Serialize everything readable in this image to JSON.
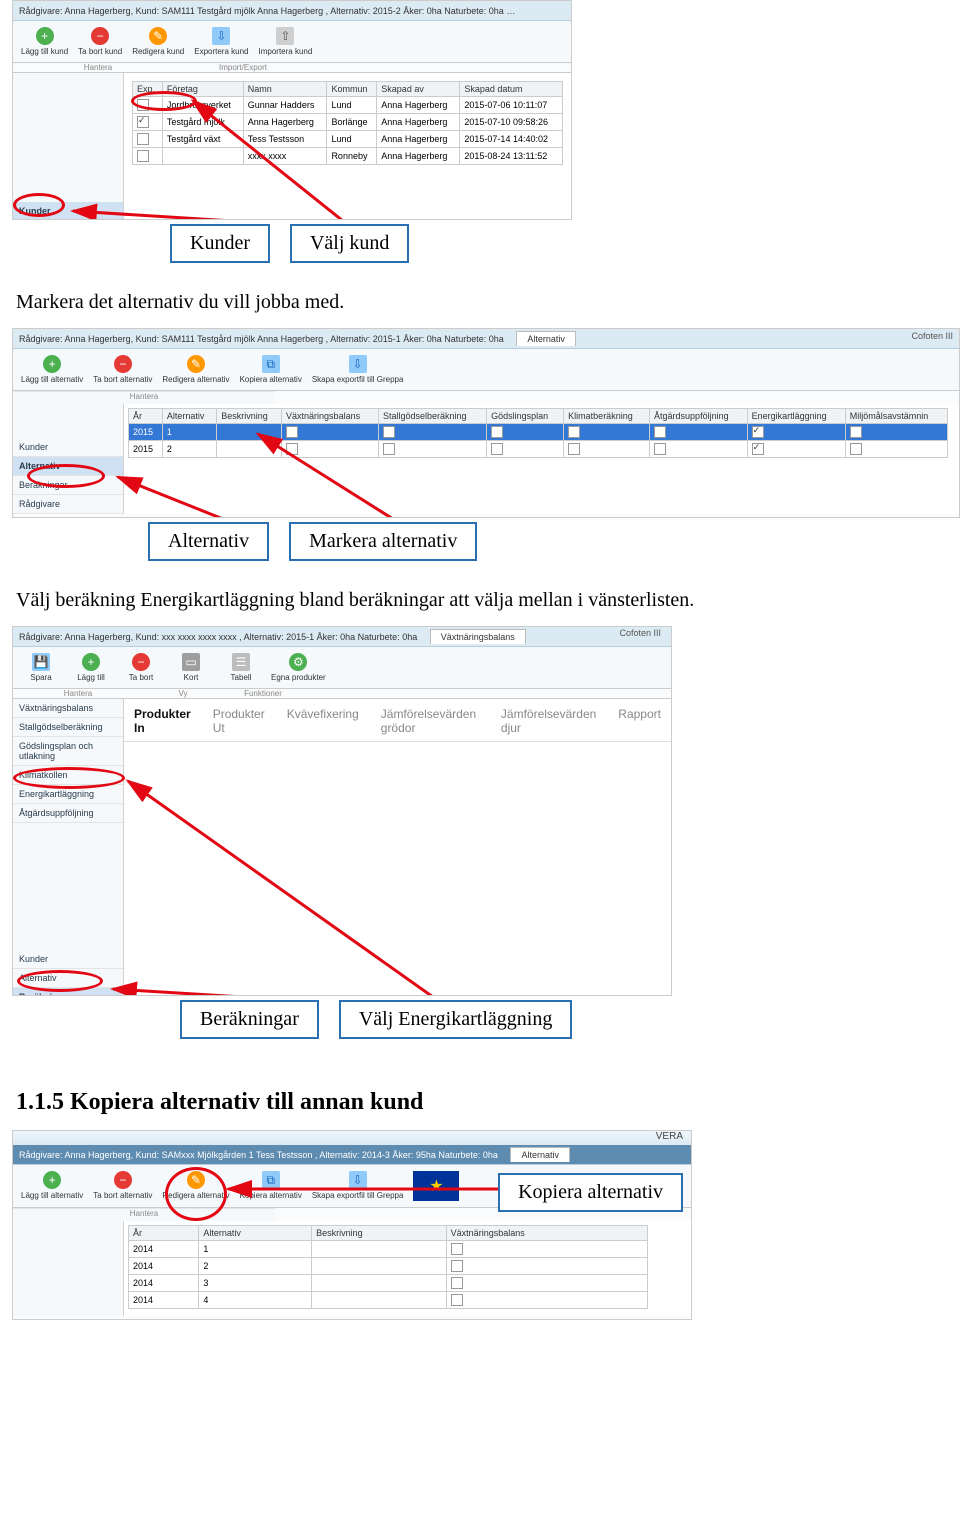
{
  "doc": {
    "para1": "Markera det alternativ du vill jobba med.",
    "para2": "Välj beräkning Energikartläggning bland beräkningar att välja mellan i vänsterlisten.",
    "heading": "1.1.5  Kopiera alternativ till annan kund"
  },
  "callouts": {
    "kunder": "Kunder",
    "valj_kund": "Välj kund",
    "alternativ": "Alternativ",
    "markera_alternativ": "Markera alternativ",
    "berakningar": "Beräkningar",
    "valj_energi": "Välj Energikartläggning",
    "kopiera_alt": "Kopiera alternativ"
  },
  "shot1": {
    "breadcrumb": "Rådgivare: Anna Hagerberg, Kund: SAM111 Testgård mjölk Anna Hagerberg , Alternativ: 2015-2 Åker: 0ha Naturbete: 0ha",
    "tab": "Kunder",
    "ribbon": {
      "lagg_till": "Lägg till kund",
      "ta_bort": "Ta bort kund",
      "redigera": "Redigera kund",
      "exportera": "Exportera kund",
      "importera": "Importera kund",
      "group1": "Hantera",
      "group2": "Import/Export"
    },
    "table": {
      "headers": {
        "exp": "Exp.",
        "foretag": "Företag",
        "namn": "Namn",
        "kommun": "Kommun",
        "skapad_av": "Skapad av",
        "skapad_datum": "Skapad datum"
      },
      "rows": [
        {
          "foretag": "Jordbruksverket",
          "namn": "Gunnar Hadders",
          "kommun": "Lund",
          "skapad_av": "Anna Hagerberg",
          "datum": "2015-07-06 10:11:07"
        },
        {
          "foretag": "Testgård mjölk",
          "namn": "Anna Hagerberg",
          "kommun": "Borlänge",
          "skapad_av": "Anna Hagerberg",
          "datum": "2015-07-10 09:58:26"
        },
        {
          "foretag": "Testgård växt",
          "namn": "Tess Testsson",
          "kommun": "Lund",
          "skapad_av": "Anna Hagerberg",
          "datum": "2015-07-14 14:40:02"
        },
        {
          "foretag": "",
          "namn": "xxxx xxxx",
          "kommun": "Ronneby",
          "skapad_av": "Anna Hagerberg",
          "datum": "2015-08-24 13:11:52"
        }
      ]
    },
    "sidebar": {
      "kunder": "Kunder"
    }
  },
  "shot2": {
    "breadcrumb": "Rådgivare: Anna Hagerberg, Kund: SAM111 Testgård mjölk Anna Hagerberg , Alternativ: 2015-1 Åker: 0ha Naturbete: 0ha",
    "tab": "Alternativ",
    "apptitle": "Cofoten III",
    "ribbon": {
      "lagg_till": "Lägg till alternativ",
      "ta_bort": "Ta bort alternativ",
      "redigera": "Redigera alternativ",
      "kopiera": "Kopiera alternativ",
      "skapa": "Skapa exportfil till Greppa",
      "group": "Hantera"
    },
    "sidebar": {
      "kunder": "Kunder",
      "alternativ": "Alternativ",
      "berakningar": "Beräkningar",
      "radgivare": "Rådgivare"
    },
    "table": {
      "headers": {
        "ar": "År",
        "alternativ": "Alternativ",
        "beskrivning": "Beskrivning",
        "vaxt": "Växtnäringsbalans",
        "stall": "Stallgödselberäkning",
        "godsel": "Gödslingsplan",
        "klimat": "Klimatberäkning",
        "atgard": "Åtgärdsuppföljning",
        "energi": "Energikartläggning",
        "miljo": "Miljömålsavstämnin"
      },
      "rows": [
        {
          "ar": "2015",
          "alt": "1",
          "energi": true
        },
        {
          "ar": "2015",
          "alt": "2",
          "energi": true
        }
      ]
    }
  },
  "shot3": {
    "breadcrumb": "Rådgivare: Anna Hagerberg, Kund: xxx xxxx xxxx xxxx , Alternativ: 2015-1 Åker: 0ha Naturbete: 0ha",
    "tab": "Växtnäringsbalans",
    "apptitle": "Cofoten III",
    "ribbon": {
      "spara": "Spara",
      "lagg_till": "Lägg till",
      "ta_bort": "Ta bort",
      "kort": "Kort",
      "tabell": "Tabell",
      "egna": "Egna produkter",
      "group1": "Hantera",
      "group2": "Vy",
      "group3": "Funktioner"
    },
    "sidebar": {
      "vaxt": "Växtnäringsbalans",
      "stall": "Stallgödselberäkning",
      "godsel": "Gödslingsplan och utlakning",
      "klimat": "Klimatkollen",
      "energi": "Energikartläggning",
      "atgard": "Åtgärdsuppföljning",
      "kunder": "Kunder",
      "alternativ": "Alternativ",
      "berakningar": "Beräkningar"
    },
    "subtabs": {
      "prod_in": "Produkter In",
      "prod_ut": "Produkter Ut",
      "kvavefix": "Kvävefixering",
      "jamf_grodor": "Jämförelsevärden grödor",
      "jamf_djur": "Jämförelsevärden djur",
      "rapport": "Rapport"
    }
  },
  "shot4": {
    "breadcrumb": "Rådgivare: Anna Hagerberg, Kund: SAMxxx Mjölkgården 1 Tess Testsson , Alternativ: 2014-3 Åker: 95ha Naturbete: 0ha",
    "tab": "Alternativ",
    "apptitle": "VERA",
    "ribbon": {
      "lagg_till": "Lägg till alternativ",
      "ta_bort": "Ta bort alternativ",
      "redigera": "Redigera alternativ",
      "kopiera": "Kopiera alternativ",
      "skapa": "Skapa exportfil till Greppa",
      "group": "Hantera"
    },
    "table": {
      "headers": {
        "ar": "År",
        "alternativ": "Alternativ",
        "beskrivning": "Beskrivning",
        "vaxt": "Växtnäringsbalans"
      },
      "rows": [
        {
          "ar": "2014",
          "alt": "1"
        },
        {
          "ar": "2014",
          "alt": "2"
        },
        {
          "ar": "2014",
          "alt": "3"
        },
        {
          "ar": "2014",
          "alt": "4"
        }
      ]
    }
  }
}
